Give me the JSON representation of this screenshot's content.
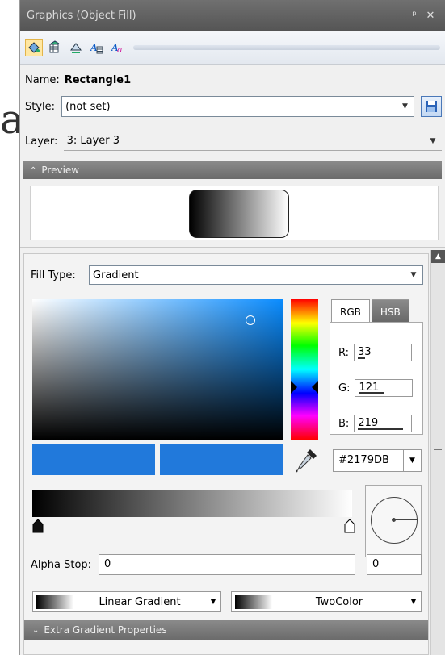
{
  "window": {
    "title": "Graphics (Object Fill)",
    "pin_glyph": "ᵖ",
    "close_glyph": "✕"
  },
  "toolbar": {
    "icons": [
      "fill-icon",
      "table-icon",
      "line-icon",
      "text-table-icon",
      "text-style-icon"
    ]
  },
  "background_char": "a",
  "name": {
    "label": "Name:",
    "value": "Rectangle1"
  },
  "style": {
    "label": "Style:",
    "value": "(not set)"
  },
  "layer": {
    "label": "Layer:",
    "value": "3: Layer 3"
  },
  "preview": {
    "label": "Preview"
  },
  "fill": {
    "type_label": "Fill Type:",
    "type_value": "Gradient",
    "color": "#2179DB",
    "tabs": [
      "RGB",
      "HSB"
    ],
    "r_label": "R:",
    "r": "33",
    "g_label": "G:",
    "g": "121",
    "b_label": "B:",
    "b": "219",
    "hex": "#2179DB"
  },
  "gradient": {
    "alpha_label": "Alpha Stop:",
    "alpha_value": "0",
    "angle_value": "0",
    "type": "Linear Gradient",
    "mode": "TwoColor"
  },
  "extra": {
    "label": "Extra Gradient Properties"
  }
}
